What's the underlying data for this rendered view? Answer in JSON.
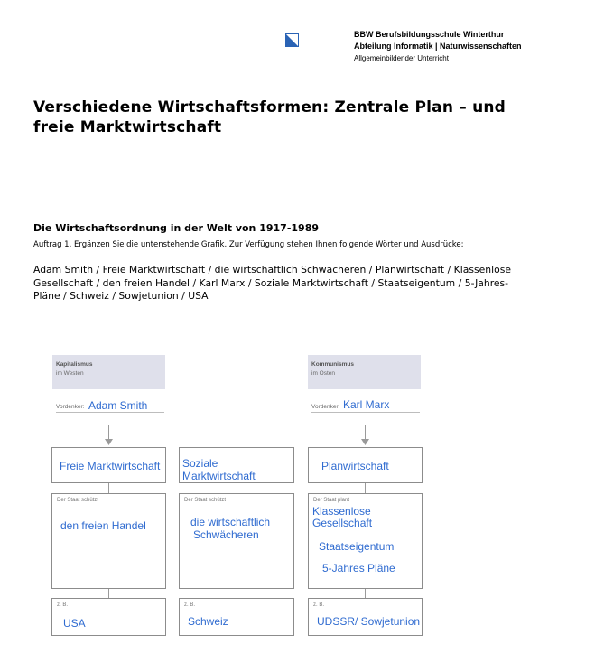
{
  "header": {
    "logo_icon": "zurich-canton-shield-icon",
    "school_line1": "BBW Berufsbildungsschule Winterthur",
    "school_line2": "Abteilung Informatik | Naturwissenschaften",
    "school_line3": "Allgemeinbildender Unterricht"
  },
  "title_line1": "Verschiedene Wirtschaftsformen: Zentrale Plan – und",
  "title_line2": "freie Marktwirtschaft",
  "subtitle": "Die Wirtschaftsordnung in der Welt von 1917-1989",
  "task": "Auftrag 1. Ergänzen Sie die untenstehende Grafik. Zur Verfügung stehen Ihnen folgende Wörter und Ausdrücke:",
  "words_line1": "Adam Smith / Freie Marktwirtschaft / die wirtschaftlich Schwächeren / Planwirtschaft / Klassenlose",
  "words_line2": "Gesellschaft / den freien Handel / Karl Marx / Soziale Marktwirtschaft / Staatseigentum / 5-Jahres-",
  "words_line3": "Pläne / Schweiz / Sowjetunion / USA",
  "diagram": {
    "left": {
      "header_title": "Kapitalismus",
      "header_sub": "im Westen",
      "thinker_label": "Vordenker:",
      "thinker": "Adam Smith",
      "system": "Freie Marktwirtschaft",
      "state_label": "Der Staat schützt",
      "state_value": "den freien Handel",
      "example_label": "z. B.",
      "example_value": "USA"
    },
    "middle": {
      "system": "Soziale Marktwirtschaft",
      "state_label": "Der Staat schützt",
      "state_value_line1": "die wirtschaftlich",
      "state_value_line2": "Schwächeren",
      "example_label": "z. B.",
      "example_value": "Schweiz"
    },
    "right": {
      "header_title": "Kommunismus",
      "header_sub": "im Osten",
      "thinker_label": "Vordenker:",
      "thinker": "Karl Marx",
      "system": "Planwirtschaft",
      "state_label": "Der Staat plant",
      "state_value_1a": "Klassenlose",
      "state_value_1b": "Gesellschaft",
      "state_value_2": "Staatseigentum",
      "state_value_3": "5-Jahres Pläne",
      "example_label": "z. B.",
      "example_value": "UDSSR/ Sowjetunion"
    }
  },
  "colors": {
    "fill_text": "#2f6bd0",
    "header_bg": "#dfe0eb",
    "box_border": "#8c8c8c"
  }
}
